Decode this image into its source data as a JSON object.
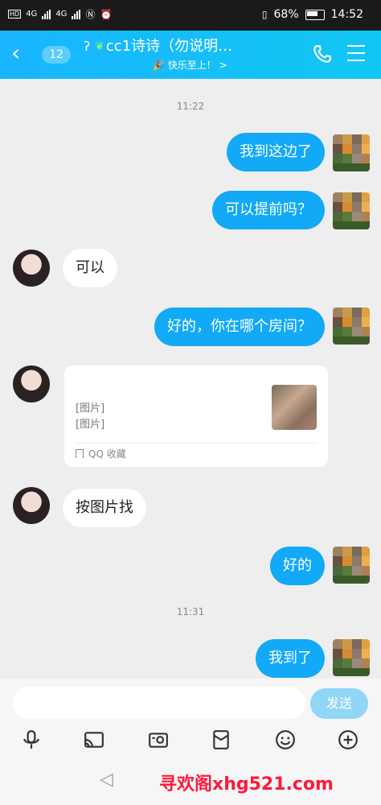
{
  "status_bar": {
    "carrier_labels": [
      "HD",
      "HD"
    ],
    "network": [
      "4G",
      "4G"
    ],
    "battery": "68%",
    "time": "14:52"
  },
  "header": {
    "back_icon": "chevron-left-icon",
    "unread_count": "12",
    "title": "cc1诗诗（勿说明…",
    "subtitle": "🎉 快乐至上！ >",
    "call_icon": "phone-icon",
    "menu_icon": "menu-icon"
  },
  "chat": {
    "time_1": "11:22",
    "time_2": "11:31",
    "messages": [
      {
        "side": "out",
        "text": "我到这边了"
      },
      {
        "side": "out",
        "text": "可以提前吗？"
      },
      {
        "side": "in",
        "text": "可以"
      },
      {
        "side": "out",
        "text": "好的，你在哪个房间？"
      },
      {
        "side": "in",
        "type": "card",
        "lines": [
          "[图片]",
          "[图片]"
        ],
        "footer": "QQ 收藏"
      },
      {
        "side": "in",
        "text": "按图片找"
      },
      {
        "side": "out",
        "text": "好的"
      },
      {
        "side": "out",
        "text": "我到了"
      }
    ]
  },
  "input": {
    "placeholder": "",
    "send_label": "发送"
  },
  "toolbar": {
    "icons": [
      "mic-icon",
      "cast-icon",
      "camera-icon",
      "red-packet-icon",
      "emoji-icon",
      "plus-icon"
    ]
  },
  "watermark": "寻欢阁xhg521.com",
  "colors": {
    "header_start": "#19b5ff",
    "header_end": "#12c7f3",
    "outgoing_bubble": "#12a9f7",
    "incoming_bubble": "#ffffff",
    "watermark": "#ff1a3a"
  }
}
